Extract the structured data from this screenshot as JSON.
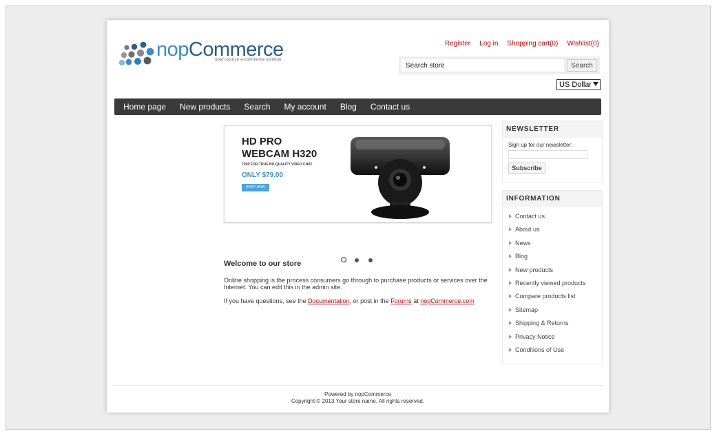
{
  "logo": {
    "name_light": "nop",
    "name_dark": "Commerce",
    "tagline": "open source e-commerce solution"
  },
  "header": {
    "links": [
      "Register",
      "Log in",
      "Shopping cart(0)",
      "Wishlist(0)"
    ],
    "search_placeholder": "Search store",
    "search_button": "Search",
    "currency": "US Dollar"
  },
  "nav": {
    "items": [
      "Home page",
      "New products",
      "Search",
      "My account",
      "Blog",
      "Contact us"
    ]
  },
  "slider": {
    "title_line1": "HD PRO",
    "title_line2": "WEBCAM H320",
    "subtitle": "720P FOR TRUE HD-QUALITY VIDEO CHAT",
    "price": "ONLY $79.00",
    "cta": "SHOP NOW",
    "dots_count": 3,
    "active_dot": 0
  },
  "welcome": {
    "title": "Welcome to our store",
    "body": "Online shopping is the process consumers go through to purchase products or services over the Internet. You can edit this in the admin site.",
    "links_prefix": "If you have questions, see the ",
    "link_docs": "Documentation",
    "links_middle": ", or post in the ",
    "link_forums": "Forums",
    "links_at": " at ",
    "link_site": "nopCommerce.com"
  },
  "newsletter": {
    "title": "NEWSLETTER",
    "label": "Sign up for our newsletter:",
    "button": "Subscribe"
  },
  "information": {
    "title": "INFORMATION",
    "items": [
      "Contact us",
      "About us",
      "News",
      "Blog",
      "New products",
      "Recently viewed products",
      "Compare products list",
      "Sitemap",
      "Shipping & Returns",
      "Privacy Notice",
      "Conditions of Use"
    ]
  },
  "footer": {
    "powered": "Powered by nopCommerce",
    "copyright": "Copyright © 2013 Your store name. All rights reserved."
  },
  "colors": {
    "link_red": "#cc0000",
    "nav_bg": "#3a3a3a",
    "brand_blue": "#3d8bc8",
    "price_blue": "#3b8fd1"
  }
}
